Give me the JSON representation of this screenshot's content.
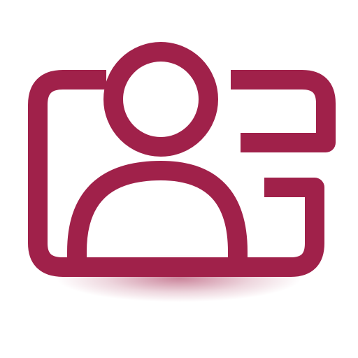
{
  "icon": {
    "name": "contact-card-icon",
    "primary_color": "#a0214a",
    "shadow_color": "#a0214a",
    "background_color": "#ffffff"
  }
}
